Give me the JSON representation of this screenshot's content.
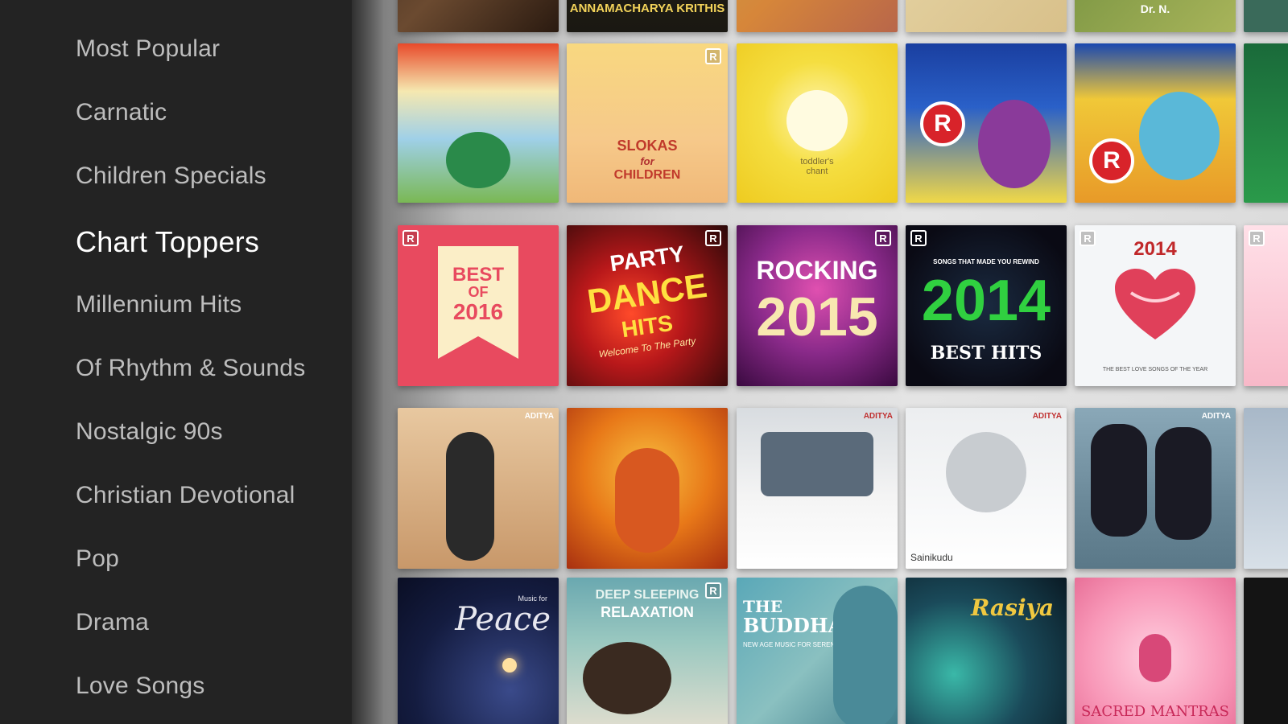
{
  "sidebar": {
    "items": [
      {
        "label": "Most Popular",
        "active": false
      },
      {
        "label": "Carnatic",
        "active": false
      },
      {
        "label": "Children Specials",
        "active": false
      },
      {
        "label": "Chart Toppers",
        "active": true
      },
      {
        "label": "Millennium Hits",
        "active": false
      },
      {
        "label": "Of Rhythm & Sounds",
        "active": false
      },
      {
        "label": "Nostalgic 90s",
        "active": false
      },
      {
        "label": "Christian Devotional",
        "active": false
      },
      {
        "label": "Pop",
        "active": false
      },
      {
        "label": "Drama",
        "active": false
      },
      {
        "label": "Love Songs",
        "active": false
      }
    ]
  },
  "tiles": {
    "row0": [
      "",
      "ANNAMACHARYA KRITHIS",
      "",
      "",
      "Dr. N.",
      ""
    ],
    "row1": {
      "slokas": "SLOKAS",
      "for": "for",
      "children": "CHILDREN",
      "toddler": "toddler's",
      "chant": "chant",
      "badge": "R"
    },
    "row2": {
      "best": "BEST",
      "of": "OF",
      "year_2016": "2016",
      "party": "PARTY",
      "dance": "DANCE",
      "hits": "HITS",
      "welcome": "Welcome To The Party",
      "rocking": "ROCKING",
      "year_2015": "2015",
      "songs_rewind": "SONGS THAT MADE YOU REWIND",
      "year_2014": "2014",
      "best_hits": "BEST HITS",
      "year_2014b": "2014",
      "love_caption": "THE BEST LOVE SONGS OF THE YEAR",
      "badge": "R"
    },
    "row3": {
      "label_aditya": "ADITYA",
      "sainikudu": "Sainikudu"
    },
    "row4": {
      "peace": "Peace",
      "peace_sub": "Music for",
      "deep_sleeping": "DEEP SLEEPING",
      "relaxation": "RELAXATION",
      "the": "THE",
      "buddha": "BUDDHA",
      "buddha_sub": "NEW AGE MUSIC FOR SERENITY",
      "rasiya": "Rasiya",
      "sacred_mantras": "SACRED MANTRAS"
    }
  },
  "colors": {
    "sidebar_bg": "#232323",
    "sidebar_text": "#bdbdbd",
    "sidebar_active": "#ffffff",
    "best2016_bg": "#e84a5f"
  }
}
